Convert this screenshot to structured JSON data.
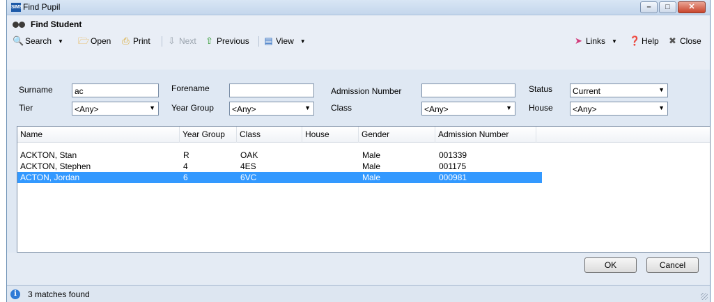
{
  "window": {
    "title": "Find Pupil",
    "app_badge": "SIMS"
  },
  "heading": "Find Student",
  "toolbar": {
    "search": "Search",
    "open": "Open",
    "print": "Print",
    "next": "Next",
    "previous": "Previous",
    "view": "View",
    "links": "Links",
    "help": "Help",
    "close": "Close"
  },
  "form": {
    "surname_label": "Surname",
    "surname_value": "ac",
    "forename_label": "Forename",
    "forename_value": "",
    "admission_label": "Admission Number",
    "admission_value": "",
    "status_label": "Status",
    "status_value": "Current",
    "tier_label": "Tier",
    "tier_value": "<Any>",
    "year_group_label": "Year Group",
    "year_group_value": "<Any>",
    "class_label": "Class",
    "class_value": "<Any>",
    "house_label": "House",
    "house_value": "<Any>"
  },
  "table": {
    "columns": [
      "Name",
      "Year Group",
      "Class",
      "House",
      "Gender",
      "Admission Number"
    ],
    "rows": [
      {
        "name": "ACKTON, Stan",
        "year": "R",
        "class": "OAK",
        "house": "",
        "gender": "Male",
        "adm": "001339",
        "selected": false
      },
      {
        "name": "ACKTON, Stephen",
        "year": "4",
        "class": "4ES",
        "house": "",
        "gender": "Male",
        "adm": "001175",
        "selected": false
      },
      {
        "name": "ACTON, Jordan",
        "year": "6",
        "class": "6VC",
        "house": "",
        "gender": "Male",
        "adm": "000981",
        "selected": true
      }
    ]
  },
  "buttons": {
    "ok": "OK",
    "cancel": "Cancel"
  },
  "status": {
    "text": "3 matches found"
  },
  "colors": {
    "selection": "#3399ff",
    "titlebar": "#c4d6ec",
    "close_button": "#c9442b"
  }
}
